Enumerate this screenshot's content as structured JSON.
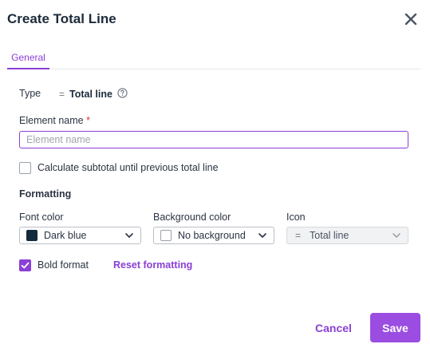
{
  "dialog": {
    "title": "Create Total Line",
    "close_icon": "close-icon"
  },
  "tabs": [
    {
      "label": "General",
      "active": true
    }
  ],
  "type_field": {
    "label": "Type",
    "symbol": "=",
    "value": "Total line",
    "help_icon": "help-icon"
  },
  "element_name": {
    "label": "Element name",
    "required_mark": "*",
    "value": "",
    "placeholder": "Element name"
  },
  "subtotal_checkbox": {
    "label": "Calculate subtotal until previous total line",
    "checked": false
  },
  "formatting": {
    "section_title": "Formatting",
    "font_color": {
      "label": "Font color",
      "value": "Dark blue",
      "swatch": "#112a3d"
    },
    "background_color": {
      "label": "Background color",
      "value": "No background"
    },
    "icon": {
      "label": "Icon",
      "symbol": "=",
      "value": "Total line",
      "disabled": true
    },
    "bold_checkbox": {
      "label": "Bold format",
      "checked": true
    },
    "reset_link": "Reset formatting"
  },
  "footer": {
    "cancel_label": "Cancel",
    "save_label": "Save"
  },
  "colors": {
    "accent": "#8a3fd6",
    "save_button": "#9a4de0",
    "title": "#1b2a3a"
  }
}
